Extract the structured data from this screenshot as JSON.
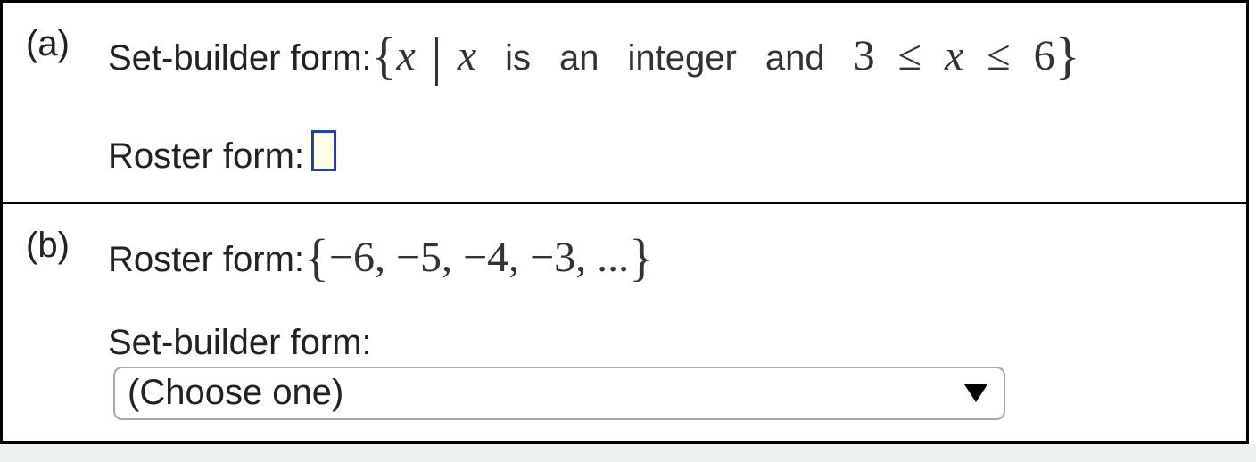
{
  "partA": {
    "label": "(a)",
    "builder_prefix": "Set-builder form: ",
    "builder_text_is": "is",
    "builder_text_an": "an",
    "builder_text_integer": "integer",
    "builder_text_and": "and",
    "var": "x",
    "low": "3",
    "high": "6",
    "le": "≤",
    "roster_label": "Roster form: ",
    "roster_value": ""
  },
  "partB": {
    "label": "(b)",
    "roster_label": "Roster form: ",
    "roster_values": "−6,  −5,  −4,  −3, ...",
    "builder_label": "Set-builder form:",
    "dropdown_selected": "(Choose one)"
  }
}
